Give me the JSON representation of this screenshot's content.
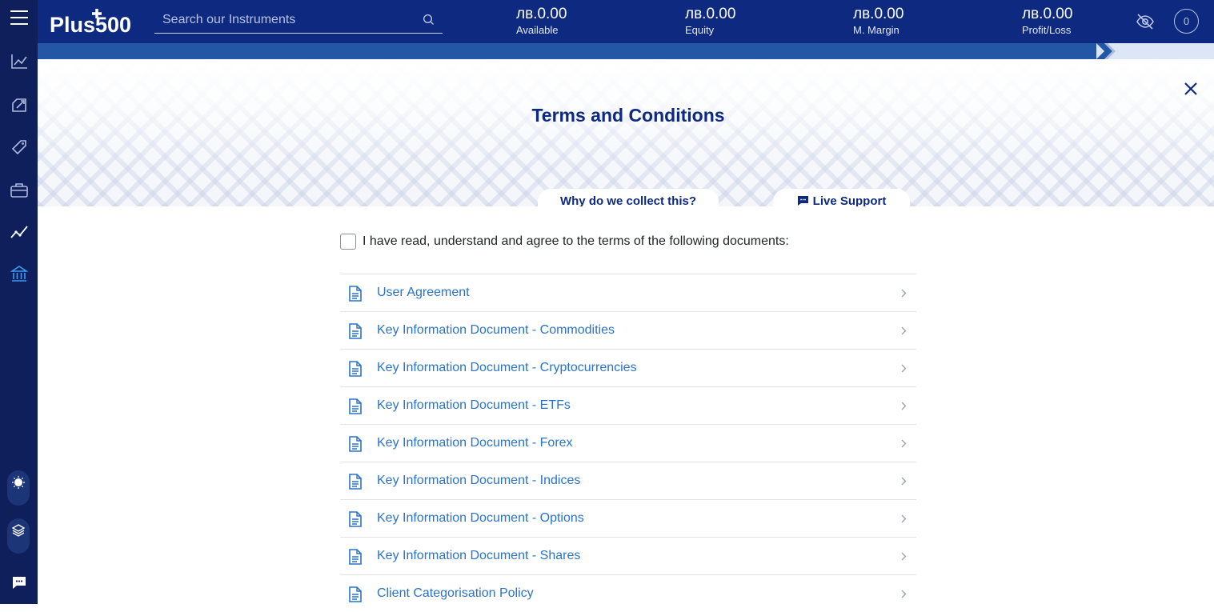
{
  "app": {
    "logo_text": "Plus500"
  },
  "header": {
    "search_placeholder": "Search our Instruments",
    "stats": [
      {
        "value": "лв.0.00",
        "label": "Available"
      },
      {
        "value": "лв.0.00",
        "label": "Equity"
      },
      {
        "value": "лв.0.00",
        "label": "M. Margin"
      },
      {
        "value": "лв.0.00",
        "label": "Profit/Loss"
      }
    ],
    "notification_count": "0"
  },
  "sidebar": {
    "items": [
      {
        "icon": "menu-icon"
      },
      {
        "icon": "chart-line-icon"
      },
      {
        "icon": "trade-edit-icon"
      },
      {
        "icon": "tag-icon"
      },
      {
        "icon": "briefcase-icon"
      },
      {
        "icon": "trend-icon"
      },
      {
        "icon": "bank-icon",
        "active": true
      }
    ],
    "bottom": [
      {
        "icon": "theme-toggle-icon"
      },
      {
        "icon": "layers-icon"
      },
      {
        "icon": "chat-icon"
      }
    ]
  },
  "progress": {
    "fraction": 0.9
  },
  "modal": {
    "title": "Terms and Conditions",
    "tabs": {
      "why": "Why do we collect this?",
      "support": "Live Support"
    },
    "agree_text": "I have read, understand and agree to the terms of the following documents:",
    "agree_checked": false,
    "documents": [
      {
        "label": "User Agreement"
      },
      {
        "label": "Key Information Document - Commodities"
      },
      {
        "label": "Key Information Document - Cryptocurrencies"
      },
      {
        "label": "Key Information Document - ETFs"
      },
      {
        "label": "Key Information Document - Forex"
      },
      {
        "label": "Key Information Document - Indices"
      },
      {
        "label": "Key Information Document - Options"
      },
      {
        "label": "Key Information Document - Shares"
      },
      {
        "label": "Client Categorisation Policy"
      }
    ]
  },
  "colors": {
    "sidebar_bg": "#0e1f5b",
    "header_bg": "#0e2a80",
    "accent_link": "#2a73c9",
    "title": "#0e2a80"
  }
}
